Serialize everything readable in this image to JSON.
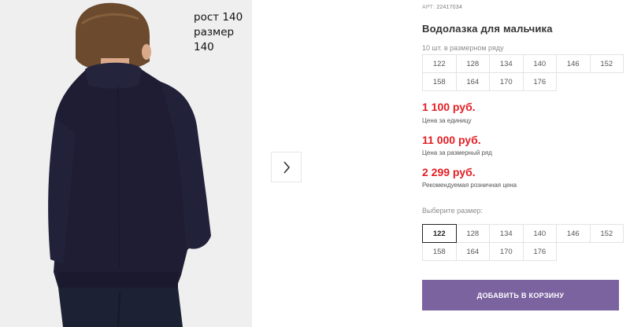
{
  "gallery": {
    "caption_line1": "рост 140",
    "caption_line2": "размер 140",
    "next_icon": "chevron-right-icon"
  },
  "product": {
    "art_label": "АРТ:",
    "art_value": "22417034",
    "title": "Водолазка для мальчика",
    "row_note": "10 шт. в размерном ряду",
    "row_sizes": [
      "122",
      "128",
      "134",
      "140",
      "146",
      "152",
      "158",
      "164",
      "170",
      "176"
    ]
  },
  "prices": {
    "unit_price": "1 100 руб.",
    "unit_note": "Цена за единицу",
    "row_price": "11 000 руб.",
    "row_price_note": "Цена за размерный ряд",
    "retail_price": "2 299 руб.",
    "retail_note": "Рекомендуемая розничная цена"
  },
  "size_picker": {
    "label": "Выберите размер:",
    "sizes": [
      "122",
      "128",
      "134",
      "140",
      "146",
      "152",
      "158",
      "164",
      "170",
      "176"
    ],
    "selected": "122"
  },
  "cart": {
    "add_label": "ДОБАВИТЬ В КОРЗИНУ"
  },
  "colors": {
    "price": "#e31e24",
    "button": "#7b63a0",
    "sweater": "#1e1d33"
  }
}
